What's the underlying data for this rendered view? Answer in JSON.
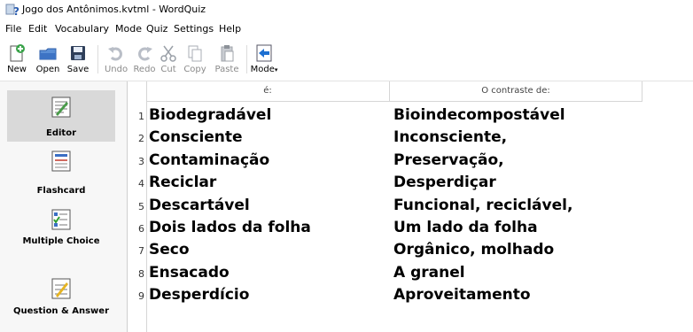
{
  "window": {
    "title": "Jogo dos Antônimos.kvtml - WordQuiz"
  },
  "menu": [
    "File",
    "Edit",
    "Vocabulary",
    "Mode",
    "Quiz",
    "Settings",
    "Help"
  ],
  "toolbar": {
    "new": "New",
    "open": "Open",
    "save": "Save",
    "undo": "Undo",
    "redo": "Redo",
    "cut": "Cut",
    "copy": "Copy",
    "paste": "Paste",
    "mode": "Mode"
  },
  "sidebar": {
    "items": [
      {
        "label": "Editor"
      },
      {
        "label": "Flashcard"
      },
      {
        "label": "Multiple Choice"
      },
      {
        "label": "Question & Answer"
      }
    ]
  },
  "table": {
    "headers": [
      "é:",
      "O contraste de:"
    ],
    "rows": [
      {
        "num": "1",
        "a": "Biodegradável",
        "b": "Bioindecompostável"
      },
      {
        "num": "2",
        "a": "Consciente",
        "b": "Inconsciente,"
      },
      {
        "num": "3",
        "a": "Contaminação",
        "b": "Preservação,"
      },
      {
        "num": "4",
        "a": "Reciclar",
        "b": "Desperdiçar"
      },
      {
        "num": "5",
        "a": "Descartável",
        "b": "Funcional, reciclável,"
      },
      {
        "num": "6",
        "a": "Dois lados da folha",
        "b": "Um lado da folha"
      },
      {
        "num": "7",
        "a": "Seco",
        "b": "Orgânico, molhado"
      },
      {
        "num": "8",
        "a": "Ensacado",
        "b": "A granel"
      },
      {
        "num": "9",
        "a": "Desperdício",
        "b": "Aproveitamento"
      }
    ]
  }
}
